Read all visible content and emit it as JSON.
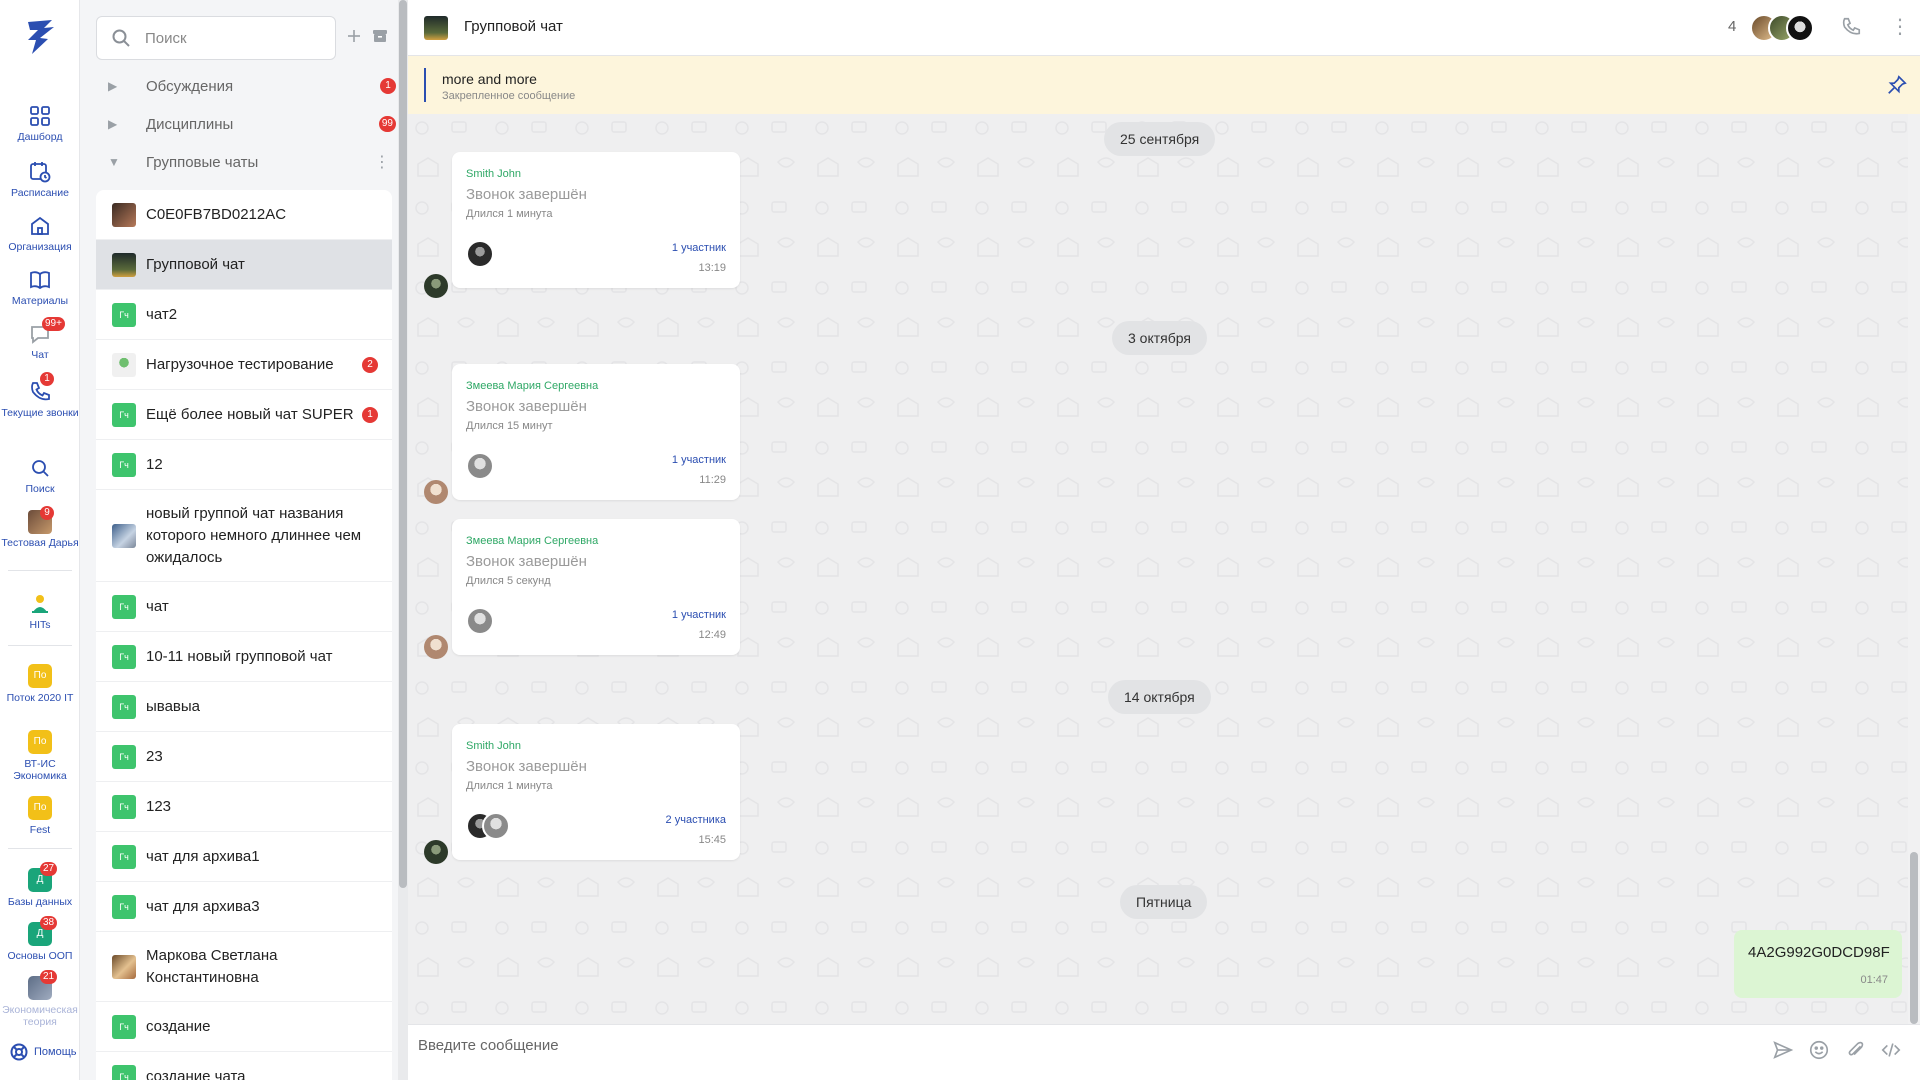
{
  "rail": {
    "items": [
      {
        "label": "Дашборд",
        "icon": "dashboard-icon"
      },
      {
        "label": "Расписание",
        "icon": "schedule-icon"
      },
      {
        "label": "Организация",
        "icon": "organization-icon"
      },
      {
        "label": "Материалы",
        "icon": "materials-icon"
      },
      {
        "label": "Чат",
        "icon": "chat-icon",
        "badge": "99+"
      },
      {
        "label": "Текущие звонки",
        "icon": "phone-icon",
        "badge": "1"
      },
      {
        "label": "Поиск",
        "icon": "search-icon"
      },
      {
        "label": "Тестовая Дарья",
        "icon": "user-avatar",
        "badge": "9"
      },
      {
        "label": "HITs",
        "icon": "hits-icon"
      },
      {
        "label": "Поток 2020 IT",
        "short": "По",
        "color": "#f2c018"
      },
      {
        "label": "ВТ-ИС Экономика",
        "short": "По",
        "color": "#f2c018"
      },
      {
        "label": "Fest",
        "short": "По",
        "color": "#f2c018"
      },
      {
        "label": "Базы данных",
        "short": "Д",
        "color": "#1aa57a",
        "badge": "27"
      },
      {
        "label": "Основы ООП",
        "short": "Д",
        "color": "#1aa57a",
        "badge": "38"
      },
      {
        "label": "Экономическая теория",
        "badge": "21"
      }
    ],
    "help_label": "Помощь"
  },
  "list": {
    "search_placeholder": "Поиск",
    "folders": [
      {
        "label": "Обсуждения",
        "badge": "1",
        "expanded": false
      },
      {
        "label": "Дисциплины",
        "badge": "99",
        "expanded": false
      },
      {
        "label": "Групповые чаты",
        "expanded": true
      }
    ],
    "chats": [
      {
        "name": "C0E0FB7BD0212AC",
        "avatar": "photo"
      },
      {
        "name": "Групповой чат",
        "avatar": "photo-dark",
        "active": true
      },
      {
        "name": "чат2",
        "avatar": "Гч"
      },
      {
        "name": "Нагрузочное тестирование",
        "avatar": "photo-robot",
        "badge": "2"
      },
      {
        "name": "Ещё более новый чат SUPER",
        "avatar": "Гч",
        "badge": "1"
      },
      {
        "name": "12",
        "avatar": "Гч"
      },
      {
        "name": "новый группой чат названия которого немного длиннее чем ожидалось",
        "avatar": "photo-blue"
      },
      {
        "name": "чат",
        "avatar": "Гч"
      },
      {
        "name": "10-11 новый групповой чат",
        "avatar": "Гч"
      },
      {
        "name": "ывавыа",
        "avatar": "Гч"
      },
      {
        "name": "23",
        "avatar": "Гч"
      },
      {
        "name": "123",
        "avatar": "Гч"
      },
      {
        "name": "чат для архива1",
        "avatar": "Гч"
      },
      {
        "name": "чат для архива3",
        "avatar": "Гч"
      },
      {
        "name": "Маркова Светлана Константиновна",
        "avatar": "photo-woman"
      },
      {
        "name": "создание",
        "avatar": "Гч"
      },
      {
        "name": "создание чата",
        "avatar": "Гч"
      }
    ]
  },
  "header": {
    "title": "Групповой чат",
    "member_count": "4"
  },
  "pinned": {
    "title": "more and more",
    "subtitle": "Закрепленное сообщение"
  },
  "messages": {
    "dates": [
      "25 сентября",
      "3 октября",
      "14 октября",
      "Пятница"
    ],
    "calls": [
      {
        "author": "Smith John",
        "title": "Звонок завершён",
        "duration": "Длился 1 минута",
        "participants": "1 участник",
        "time": "13:19"
      },
      {
        "author": "Змеева Мария Сергеевна",
        "title": "Звонок завершён",
        "duration": "Длился 15 минут",
        "participants": "1 участник",
        "time": "11:29"
      },
      {
        "author": "Змеева Мария Сергеевна",
        "title": "Звонок завершён",
        "duration": "Длился 5 секунд",
        "participants": "1 участник",
        "time": "12:49"
      },
      {
        "author": "Smith John",
        "title": "Звонок завершён",
        "duration": "Длился 1 минута",
        "participants": "2 участника",
        "time": "15:45"
      }
    ],
    "own": {
      "text": "4A2G992G0DCD98F",
      "time": "01:47"
    }
  },
  "composer": {
    "placeholder": "Введите сообщение"
  },
  "colors": {
    "accent": "#2b4eb1",
    "green_chat": "#3ec46d",
    "badge_red": "#e53935",
    "pinned_bg": "#fdf5dc",
    "own_msg_bg": "#dcf5d3",
    "author_green": "#2fa866"
  }
}
